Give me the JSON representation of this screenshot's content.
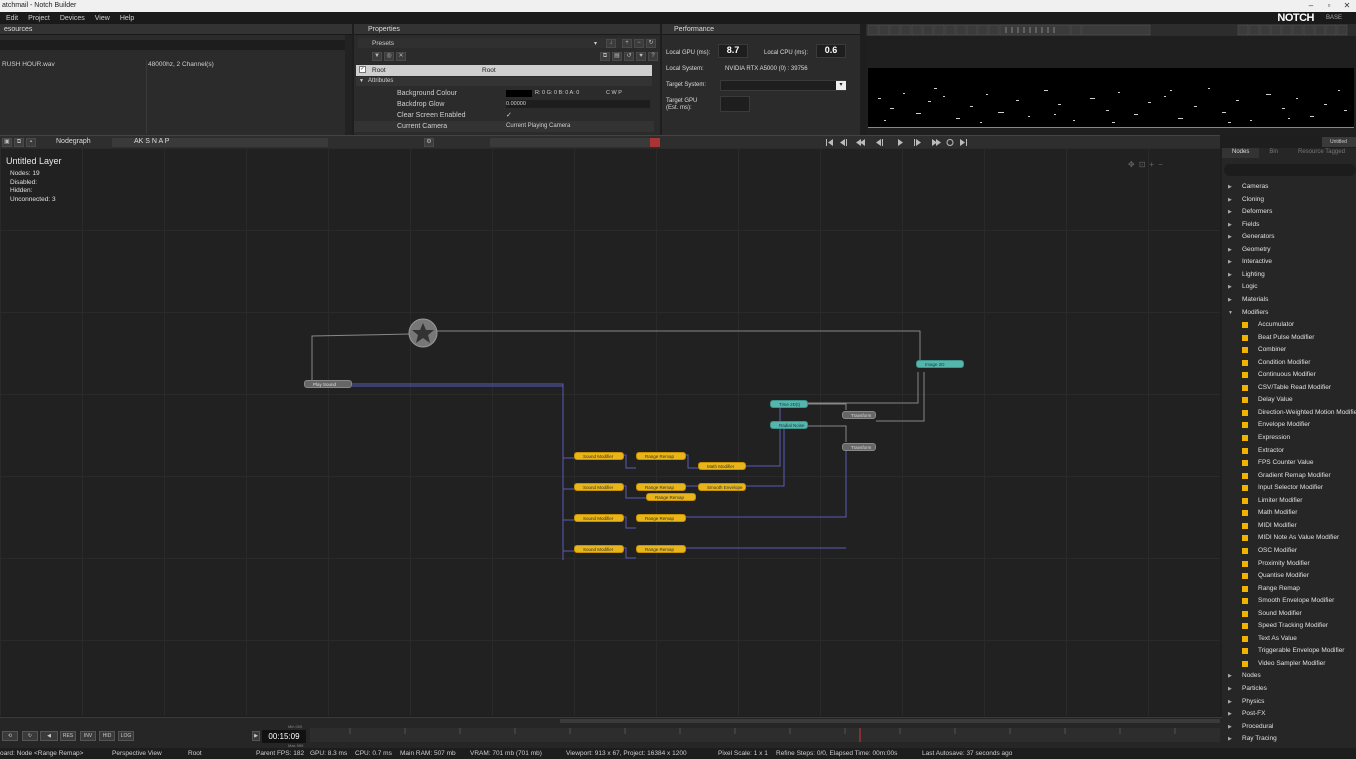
{
  "window": {
    "title": "atchmail - Notch Builder"
  },
  "menu": [
    "Edit",
    "Project",
    "Devices",
    "View",
    "Help"
  ],
  "logo": {
    "main": "NOTCH",
    "sub": "BASE"
  },
  "resources": {
    "title": "esources",
    "file_name": "RUSH HOUR.wav",
    "file_info": "48000hz, 2 Channel(s)"
  },
  "properties": {
    "title": "Properties",
    "presets_label": "Presets",
    "root_left": "Root",
    "root_right": "Root",
    "attributes_label": "Attributes",
    "rows": [
      {
        "label": "Background Colour",
        "value": "R: 0 G: 0 B: 0 A: 0",
        "extra": "C  W  P"
      },
      {
        "label": "Backdrop Glow",
        "value": "0.00000",
        "extra": ""
      },
      {
        "label": "Clear Screen Enabled",
        "value": "✓",
        "extra": ""
      },
      {
        "label": "Current Camera",
        "value": "Current Playing Camera",
        "extra": ""
      }
    ]
  },
  "performance": {
    "title": "Performance",
    "gpu_label": "Local GPU (ms):",
    "gpu_value": "8.7",
    "cpu_label": "Local CPU (ms):",
    "cpu_value": "0.6",
    "system_label": "Local System:",
    "system_value": "NVIDIA RTX A5000 (0) : 39756",
    "target_label": "Target System:",
    "target_gpu_label": "Target GPU",
    "target_gpu_label2": "(Est. ms):"
  },
  "nodegraph": {
    "tab": "Nodegraph",
    "toolbar_text": "AK  S  N  A  P",
    "layer_title": "Untitled  Layer",
    "stats": [
      {
        "label": "Nodes:",
        "value": "19"
      },
      {
        "label": "Disabled:",
        "value": ""
      },
      {
        "label": "Hidden:",
        "value": ""
      },
      {
        "label": "Unconnected:",
        "value": "3"
      }
    ],
    "nodes": {
      "play_sound": "Play Sound",
      "image_2d": "Image 2D",
      "time_2d": "Time 2D(t)",
      "radial_noise": "Radial Noise",
      "transform1": "Transform",
      "transform2": "Transform",
      "sound_mod_1": "Sound Modifier",
      "sound_mod_2": "Sound Modifier",
      "sound_mod_3": "Sound Modifier",
      "sound_mod_4": "Sound Modifier",
      "range_remap_1": "Range Remap",
      "range_remap_2": "Range Remap",
      "range_remap_3": "Range Remap",
      "range_remap_4": "Range Remap",
      "range_remap_5": "Range Remap",
      "math_mod": "Math Modifier",
      "smooth_env": "Smooth Envelope"
    }
  },
  "library": {
    "tabs": [
      "Nodes",
      "Bin",
      "Resource Tagged"
    ],
    "top_tag": "Untitled",
    "categories_top": [
      "Cameras",
      "Cloning",
      "Deformers",
      "Fields",
      "Generators",
      "Geometry",
      "Interactive",
      "Lighting",
      "Logic",
      "Materials",
      "Modifiers"
    ],
    "modifiers": [
      "Accumulator",
      "Beat Pulse Modifier",
      "Combiner",
      "Condition Modifier",
      "Continuous Modifier",
      "CSV/Table Read Modifier",
      "Delay Value",
      "Direction-Weighted Motion Modifier",
      "Envelope Modifier",
      "Expression",
      "Extractor",
      "FPS Counter Value",
      "Gradient Remap Modifier",
      "Input Selector Modifier",
      "Limiter Modifier",
      "Math Modifier",
      "MIDI Modifier",
      "MIDI Note As Value Modifier",
      "OSC Modifier",
      "Proximity Modifier",
      "Quantise Modifier",
      "Range Remap",
      "Smooth Envelope Modifier",
      "Sound Modifier",
      "Speed Tracking Modifier",
      "Text As Value",
      "Triggerable Envelope Modifier",
      "Video Sampler Modifier"
    ],
    "categories_bottom": [
      "Nodes",
      "Particles",
      "Physics",
      "Post-FX",
      "Procedural",
      "Ray Tracing"
    ]
  },
  "timeline": {
    "timecode": "00:15:09",
    "min_label": "Min 000",
    "max_label": "Max 999",
    "buttons": [
      "RES",
      "INV",
      "HID",
      "LOG"
    ]
  },
  "status": {
    "node": "oard: Node <Range Remap>",
    "view": "Perspective View",
    "root": "Root",
    "parent": "Parent  FPS: 182",
    "gpu": "GPU: 8.3 ms",
    "cpu": "CPU: 0.7 ms",
    "ram": "Main RAM: 507 mb",
    "vram": "VRAM: 701 mb (701 mb)",
    "viewport": "Viewport: 913 x 67, Project: 16384 x 1200",
    "pixel": "Pixel Scale: 1 x 1",
    "refine": "Refine Steps: 0/0, Elapsed Time: 00m:00s",
    "autosave": "Last Autosave: 37 seconds ago"
  }
}
